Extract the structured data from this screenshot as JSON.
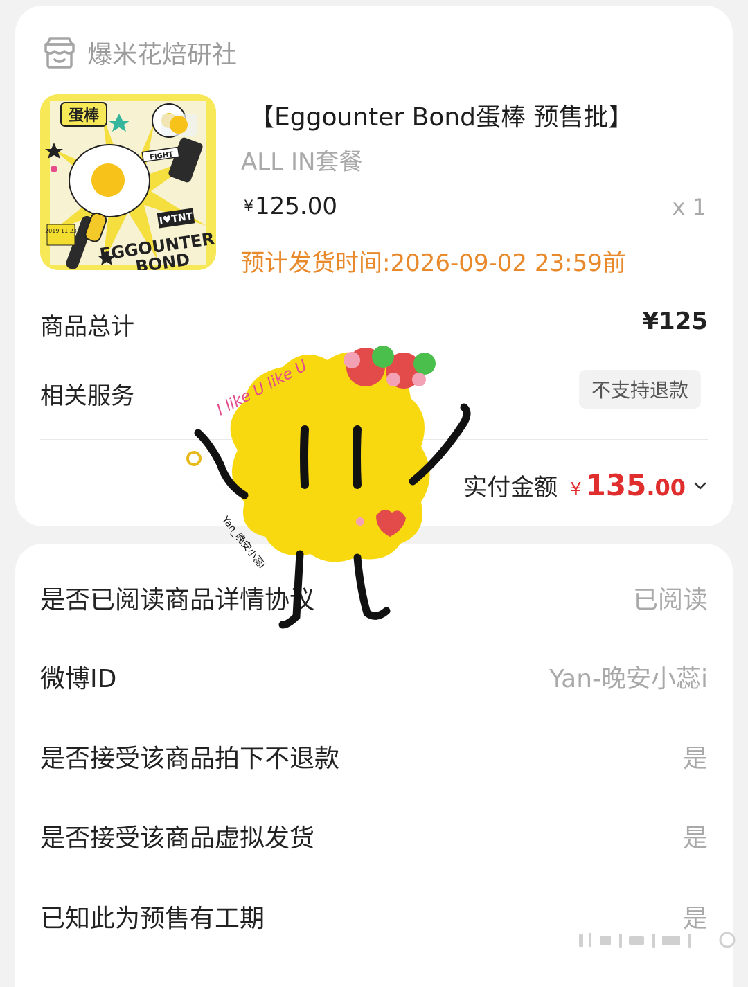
{
  "shop": {
    "name": "爆米花焙研社",
    "icon": "shop-icon"
  },
  "product": {
    "title": "【Eggounter Bond蛋棒 预售批】",
    "sku": "ALL IN套餐",
    "price_symbol": "¥",
    "price": "125.00",
    "qty": "x 1",
    "ship_time": "预计发货时间:2026-09-02 23:59前",
    "image_texts": {
      "cn": "蛋棒",
      "fight": "FIGHT",
      "tnt": "I♥TNT",
      "date": "2019 11.23",
      "brand1": "EGGOUNTER",
      "brand2": "BOND"
    }
  },
  "summary": {
    "total_label": "商品总计",
    "total_value": "¥125",
    "service_label": "相关服务",
    "service_badge": "不支持退款",
    "paid_label": "实付金额",
    "paid_symbol": "¥",
    "paid_int": "135",
    "paid_dec": ".00"
  },
  "questions": [
    {
      "label": "是否已阅读商品详情协议",
      "value": "已阅读"
    },
    {
      "label": "微博ID",
      "value": "Yan-晚安小蕊i"
    },
    {
      "label": "是否接受该商品拍下不退款",
      "value": "是"
    },
    {
      "label": "是否接受该商品虚拟发货",
      "value": "是"
    },
    {
      "label": "已知此为预售有工期",
      "value": "是"
    }
  ],
  "sticker": {
    "top_text": "I like U like U",
    "side_text": "Yan_晚安小蕊i"
  },
  "colors": {
    "accent_orange": "#e8892b",
    "price_red": "#e02d2d",
    "muted": "#a9a9a9",
    "sticker_yellow": "#f8d90f"
  }
}
